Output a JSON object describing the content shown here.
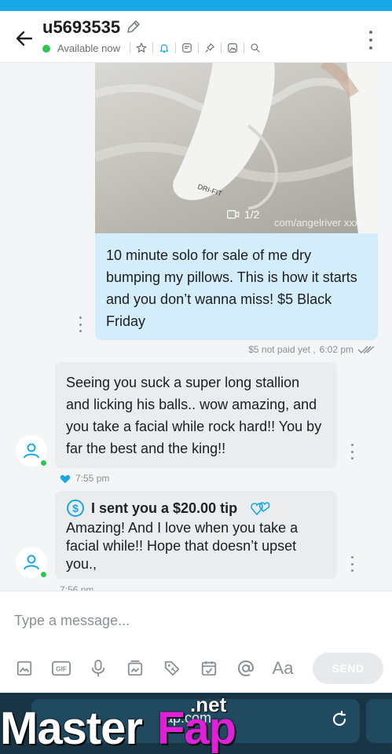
{
  "header": {
    "username": "u5693535",
    "status": "Available now",
    "icons": [
      "star-icon",
      "bell-icon",
      "note-icon",
      "pin-icon",
      "image-icon",
      "search-icon"
    ]
  },
  "messages": {
    "outgoing": {
      "media_counter": "1/2",
      "media_watermark": "com/angelriver xxx",
      "text": "10 minute solo for sale of me dry bumping my pillows. This is how it starts and you don’t wanna miss! $5 Black Friday",
      "price_status": "$5 not paid yet ,",
      "time": "6:02 pm"
    },
    "incoming_1": {
      "text": "Seeing you suck a super long stallion and licking his balls.. wow amazing, and you take a facial while rock hard!! You by far the best and the king!!",
      "time": "7:55 pm"
    },
    "incoming_2": {
      "tip": "I sent you a $20.00 tip",
      "text": "Amazing! And I love when you take a facial while!! Hope that doesn’t upset you.,",
      "time": "7:56 pm"
    }
  },
  "composer": {
    "placeholder": "Type a message...",
    "gif_label": "GIF",
    "font_label": "Aa",
    "send_label": "SEND"
  },
  "browser": {
    "url_fragment": "ap.com"
  },
  "watermark": {
    "part1": "Master",
    "part2": "Fap",
    "part3": ".net"
  },
  "colors": {
    "accent": "#18a8e6",
    "online": "#2dc653",
    "outgoing_bubble": "#d4edfa",
    "incoming_bubble": "#eaecee"
  }
}
